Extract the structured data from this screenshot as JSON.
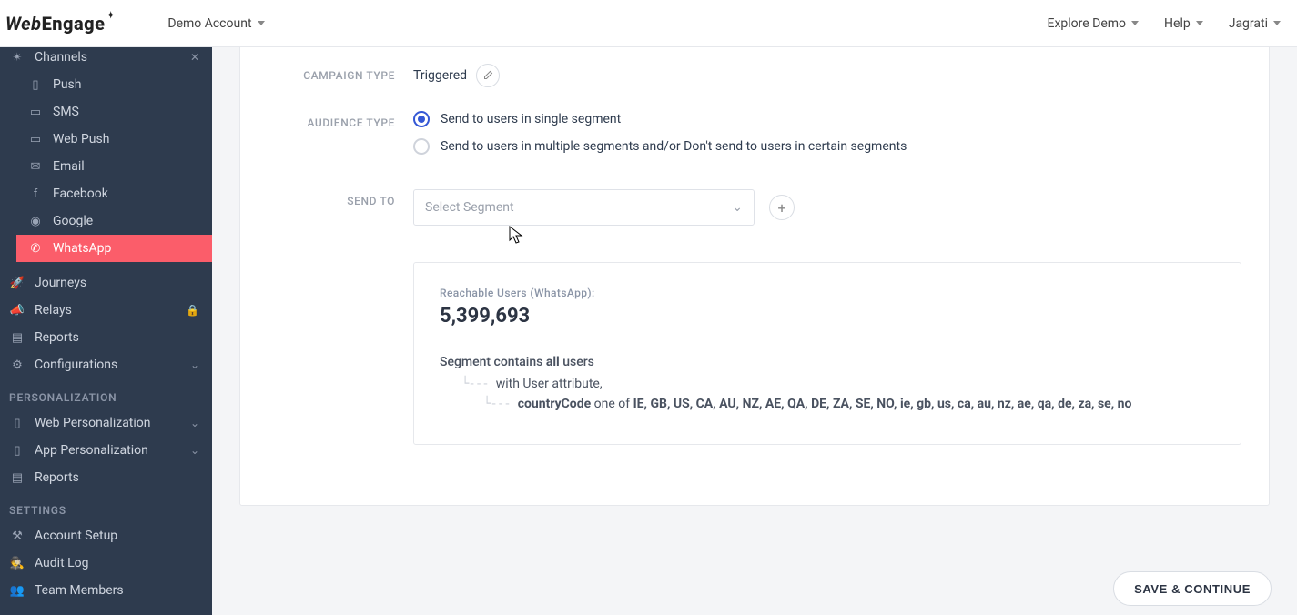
{
  "header": {
    "logo_text": "WebEngage",
    "account_label": "Demo Account",
    "explore_label": "Explore Demo",
    "help_label": "Help",
    "user_label": "Jagrati"
  },
  "sidebar": {
    "channels_header": "Channels",
    "items": [
      {
        "label": "Push"
      },
      {
        "label": "SMS"
      },
      {
        "label": "Web Push"
      },
      {
        "label": "Email"
      },
      {
        "label": "Facebook"
      },
      {
        "label": "Google"
      },
      {
        "label": "WhatsApp"
      }
    ],
    "journeys": "Journeys",
    "relays": "Relays",
    "reports": "Reports",
    "configurations": "Configurations",
    "section_personalization": "PERSONALIZATION",
    "web_personalization": "Web Personalization",
    "app_personalization": "App Personalization",
    "reports2": "Reports",
    "section_settings": "SETTINGS",
    "account_setup": "Account Setup",
    "audit_log": "Audit Log",
    "team_members": "Team Members"
  },
  "form": {
    "campaign_type_label": "CAMPAIGN TYPE",
    "campaign_type_value": "Triggered",
    "audience_type_label": "AUDIENCE TYPE",
    "audience_option_single": "Send to users in single segment",
    "audience_option_multi": "Send to users in multiple segments and/or Don't send to users in certain segments",
    "send_to_label": "SEND TO",
    "segment_placeholder": "Select Segment",
    "panel": {
      "reach_title": "Reachable Users (WhatsApp):",
      "reach_value": "5,399,693",
      "seg_contains_prefix": "Segment contains ",
      "seg_contains_bold": "all",
      "seg_contains_suffix": " users",
      "line_attr": "with User attribute,",
      "country_key": "countryCode",
      "country_mid": " one of ",
      "country_list": "IE, GB, US, CA, AU, NZ, AE, QA, DE, ZA, SE, NO, ie, gb, us, ca, au, nz, ae, qa, de, za, se, no"
    }
  },
  "footer": {
    "save_label": "SAVE & CONTINUE"
  }
}
